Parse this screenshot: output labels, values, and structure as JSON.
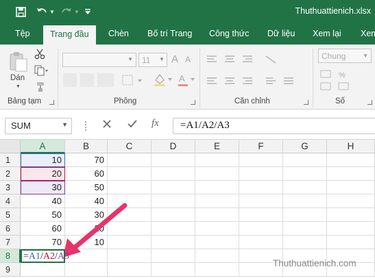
{
  "window": {
    "title": "Thuthuattienich.xlsx",
    "accent_color": "#217346"
  },
  "quick_access": {
    "save_icon": "save-icon",
    "undo_icon": "undo-icon",
    "redo_icon": "redo-icon",
    "customize_icon": "customize-qat-icon"
  },
  "ribbon_tabs": [
    {
      "label": "Tệp",
      "active": false
    },
    {
      "label": "Trang đầu",
      "active": true
    },
    {
      "label": "Chèn",
      "active": false
    },
    {
      "label": "Bố trí Trang",
      "active": false
    },
    {
      "label": "Công thức",
      "active": false
    },
    {
      "label": "Dữ liệu",
      "active": false
    },
    {
      "label": "Xem lại",
      "active": false
    },
    {
      "label": "Xem",
      "active": false
    }
  ],
  "ribbon": {
    "clipboard": {
      "label": "Bảng tạm",
      "paste_label": "Dán"
    },
    "font": {
      "label": "Phông",
      "font_size": "11",
      "grow_glyph": "A",
      "shrink_glyph": "A"
    },
    "alignment": {
      "label": "Căn chỉnh"
    },
    "number": {
      "label": "Số",
      "format": "Chung"
    }
  },
  "formula_bar": {
    "name_box": "SUM",
    "fx_label": "fx",
    "formula": "=A1/A2/A3"
  },
  "sheet": {
    "columns": [
      "A",
      "B",
      "C",
      "D",
      "E",
      "F",
      "G",
      "H"
    ],
    "selected_column": "A",
    "selected_row": "8",
    "rows": [
      {
        "row": "1",
        "A": "10",
        "B": "70"
      },
      {
        "row": "2",
        "A": "20",
        "B": "60"
      },
      {
        "row": "3",
        "A": "30",
        "B": "50"
      },
      {
        "row": "4",
        "A": "40",
        "B": "40"
      },
      {
        "row": "5",
        "A": "50",
        "B": "30"
      },
      {
        "row": "6",
        "A": "60",
        "B": "20"
      },
      {
        "row": "7",
        "A": "70",
        "B": "10"
      },
      {
        "row": "8",
        "A": "",
        "B": ""
      },
      {
        "row": "9",
        "A": "",
        "B": ""
      }
    ],
    "editing_cell": {
      "address": "A8",
      "parts": [
        {
          "text": "=",
          "color": "#222222"
        },
        {
          "text": "A1",
          "color": "#3a66c4"
        },
        {
          "text": "/",
          "color": "#222222"
        },
        {
          "text": "A2",
          "color": "#c8102e"
        },
        {
          "text": "/",
          "color": "#222222"
        },
        {
          "text": "A3",
          "color": "#7a3ea6"
        }
      ]
    },
    "reference_colors": {
      "A1": "#3a66c4",
      "A2": "#c8102e",
      "A3": "#7a3ea6"
    }
  },
  "annotation": {
    "arrow_color": "#e8336b"
  },
  "watermark": "Thuthuattienich.com"
}
